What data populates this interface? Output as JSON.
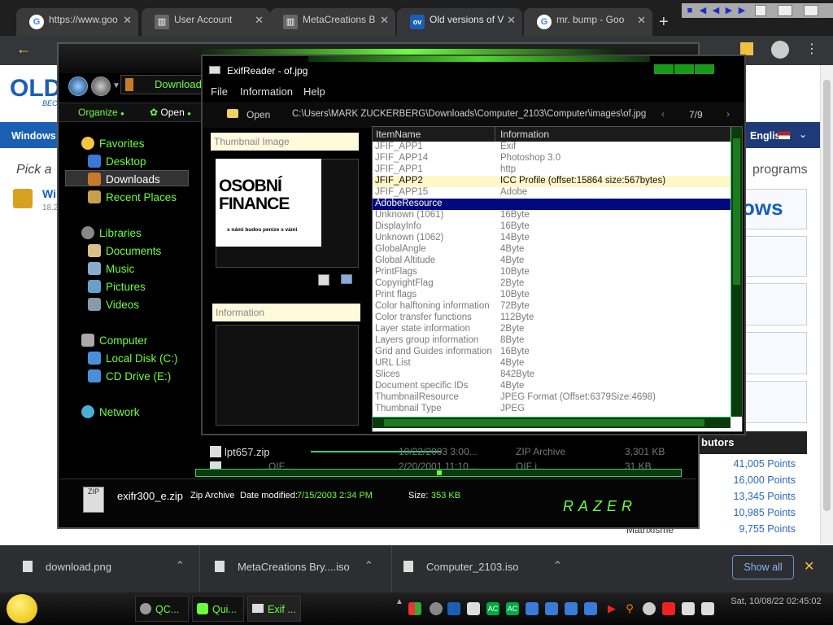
{
  "browser": {
    "tabs": [
      {
        "label": "https://www.goo",
        "icon": "google-icon"
      },
      {
        "label": "User Account",
        "icon": "archive-icon"
      },
      {
        "label": "MetaCreations B",
        "icon": "archive-icon"
      },
      {
        "label": "Old versions of V",
        "icon": "ov-icon",
        "active": true
      },
      {
        "label": "mr. bump - Goo",
        "icon": "google-icon"
      }
    ],
    "new_tab": "+",
    "fav_ov": "ov"
  },
  "site": {
    "logo": "OLD",
    "logo_sub": "BEC",
    "nav_left": "Windows",
    "pick": "Pick a",
    "item_name": "Wi",
    "item_sub": "18.2",
    "language": "English",
    "programs": "programs",
    "win_fragment": "ows",
    "contrib_header": "butors",
    "points": [
      "41,005 Points",
      "16,000 Points",
      "13,345 Points",
      "10,985 Points",
      "9,755 Points"
    ],
    "last_user": "Matrixisme"
  },
  "explorer": {
    "address": "Download",
    "organize": "Organize",
    "open": "Open",
    "sidebar": [
      {
        "label": "Favorites",
        "icon": "star-icon",
        "color": "#f5c542"
      },
      {
        "label": "Desktop",
        "icon": "desktop-icon",
        "color": "#3a78d8"
      },
      {
        "label": "Downloads",
        "icon": "downloads-folder-icon",
        "color": "#c87a2a",
        "selected": true
      },
      {
        "label": "Recent Places",
        "icon": "recent-places-icon",
        "color": "#c8a04a"
      },
      {
        "label": "Libraries",
        "icon": "libraries-icon",
        "color": "#888888"
      },
      {
        "label": "Documents",
        "icon": "documents-icon",
        "color": "#d8c088"
      },
      {
        "label": "Music",
        "icon": "music-icon",
        "color": "#88aacc"
      },
      {
        "label": "Pictures",
        "icon": "pictures-icon",
        "color": "#6aa0c8"
      },
      {
        "label": "Videos",
        "icon": "videos-icon",
        "color": "#8899aa"
      },
      {
        "label": "Computer",
        "icon": "computer-icon",
        "color": "#aaaaaa"
      },
      {
        "label": "Local Disk (C:)",
        "icon": "local-disk-icon",
        "color": "#4a90d8"
      },
      {
        "label": "CD Drive (E:)",
        "icon": "cd-drive-icon",
        "color": "#4a90d8"
      },
      {
        "label": "Network",
        "icon": "network-icon",
        "color": "#4ab0d8"
      }
    ],
    "files": [
      {
        "name": "lpt657.zip",
        "date": "10/22/2003 3:00...",
        "type": "ZIP Archive",
        "size": "3,301 KB"
      },
      {
        "name": "...OIF...",
        "date": "2/20/2001 11:10...",
        "type": "OIF i...",
        "size": "31 KB"
      }
    ],
    "details": {
      "file_name": "exifr300_e.zip",
      "type": "Zip Archive",
      "date_label": "Date modified:",
      "date_value": "7/15/2003 2:34 PM",
      "size_label": "Size:",
      "size_value": "353 KB",
      "brand": "RAZER"
    }
  },
  "exif": {
    "title": "ExifReader - of.jpg",
    "menu": [
      "File",
      "Information",
      "Help"
    ],
    "open_label": "Open",
    "path": "C:\\Users\\MARK ZUCKERBERG\\Downloads\\Computer_2103\\Computer\\images\\of.jpg",
    "page": "7/9",
    "thumb_head": "Thumbnail Image",
    "info_head": "Information",
    "thumb": {
      "line1": "OSOBNÍ",
      "line2": "FINANCE",
      "line3": "s námi budou peníze s vámi"
    },
    "columns": [
      "ItemName",
      "Information"
    ],
    "rows": [
      {
        "name": "JFIF_APP1",
        "info": "Exif"
      },
      {
        "name": "JFIF_APP14",
        "info": "Photoshop 3.0"
      },
      {
        "name": "JFIF_APP1",
        "info": "http"
      },
      {
        "name": "JFIF_APP2",
        "info": "ICC Profile (offset:15864 size:567bytes)",
        "state": "hl"
      },
      {
        "name": "JFIF_APP15",
        "info": "Adobe"
      },
      {
        "name": "AdobeResource",
        "info": "",
        "state": "sel"
      },
      {
        "name": "Unknown (1061)",
        "info": "16Byte"
      },
      {
        "name": "DisplayInfo",
        "info": "16Byte"
      },
      {
        "name": "Unknown (1062)",
        "info": "14Byte"
      },
      {
        "name": "GlobalAngle",
        "info": "4Byte"
      },
      {
        "name": "Global Altitude",
        "info": "4Byte"
      },
      {
        "name": "PrintFlags",
        "info": "10Byte"
      },
      {
        "name": "CopyrightFlag",
        "info": "2Byte"
      },
      {
        "name": "Print flags",
        "info": "10Byte"
      },
      {
        "name": "Color halftoning information",
        "info": "72Byte"
      },
      {
        "name": "Color transfer functions",
        "info": "112Byte"
      },
      {
        "name": "Layer state information",
        "info": "2Byte"
      },
      {
        "name": "Layers group information",
        "info": "8Byte"
      },
      {
        "name": "Grid and Guides information",
        "info": "16Byte"
      },
      {
        "name": "URL List",
        "info": "4Byte"
      },
      {
        "name": "Slices",
        "info": "842Byte"
      },
      {
        "name": "Document specific IDs",
        "info": "4Byte"
      },
      {
        "name": "ThumbnailResource",
        "info": "JPEG Format (Offset:6379Size:4698)"
      },
      {
        "name": "Thumbnail Type",
        "info": "JPEG"
      }
    ]
  },
  "downloads": {
    "items": [
      {
        "name": "download.png",
        "icon": "image-file-icon"
      },
      {
        "name": "MetaCreations Bry....iso",
        "icon": "iso-file-icon"
      },
      {
        "name": "Computer_2103.iso",
        "icon": "iso-file-icon"
      }
    ],
    "show_all": "Show all"
  },
  "taskbar": {
    "buttons": [
      {
        "label": "QC...",
        "icon": "qc-icon"
      },
      {
        "label": "Qui...",
        "icon": "quick-icon"
      },
      {
        "label": "Exif ...",
        "icon": "exif-icon"
      }
    ],
    "clock": "Sat, 10/08/22 02:45:02",
    "tray_ac": "AC"
  }
}
